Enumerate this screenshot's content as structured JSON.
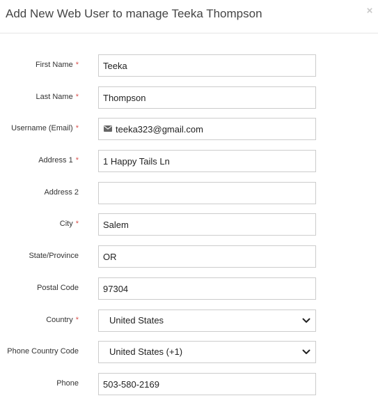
{
  "modal": {
    "title": "Add New Web User to manage Teeka Thompson",
    "close_glyph": "×"
  },
  "form": {
    "fields": [
      {
        "label": "First Name",
        "required": true,
        "value": "Teeka"
      },
      {
        "label": "Last Name",
        "required": true,
        "value": "Thompson"
      },
      {
        "label": "Username (Email)",
        "required": true,
        "value": "teeka323@gmail.com",
        "icon": "envelope-icon"
      },
      {
        "label": "Address 1",
        "required": true,
        "value": "1 Happy Tails Ln"
      },
      {
        "label": "Address 2",
        "required": false,
        "value": ""
      },
      {
        "label": "City",
        "required": true,
        "value": "Salem"
      },
      {
        "label": "State/Province",
        "required": false,
        "value": "OR"
      },
      {
        "label": "Postal Code",
        "required": false,
        "value": "97304"
      },
      {
        "label": "Country",
        "required": true,
        "value": "United States",
        "type": "select"
      },
      {
        "label": "Phone Country Code",
        "required": false,
        "value": "United States (+1)",
        "type": "select"
      },
      {
        "label": "Phone",
        "required": false,
        "value": "503-580-2169"
      }
    ],
    "required_marker": "*"
  },
  "colors": {
    "required": "#d9534f",
    "border": "#cccccc",
    "icon": "#666666"
  }
}
